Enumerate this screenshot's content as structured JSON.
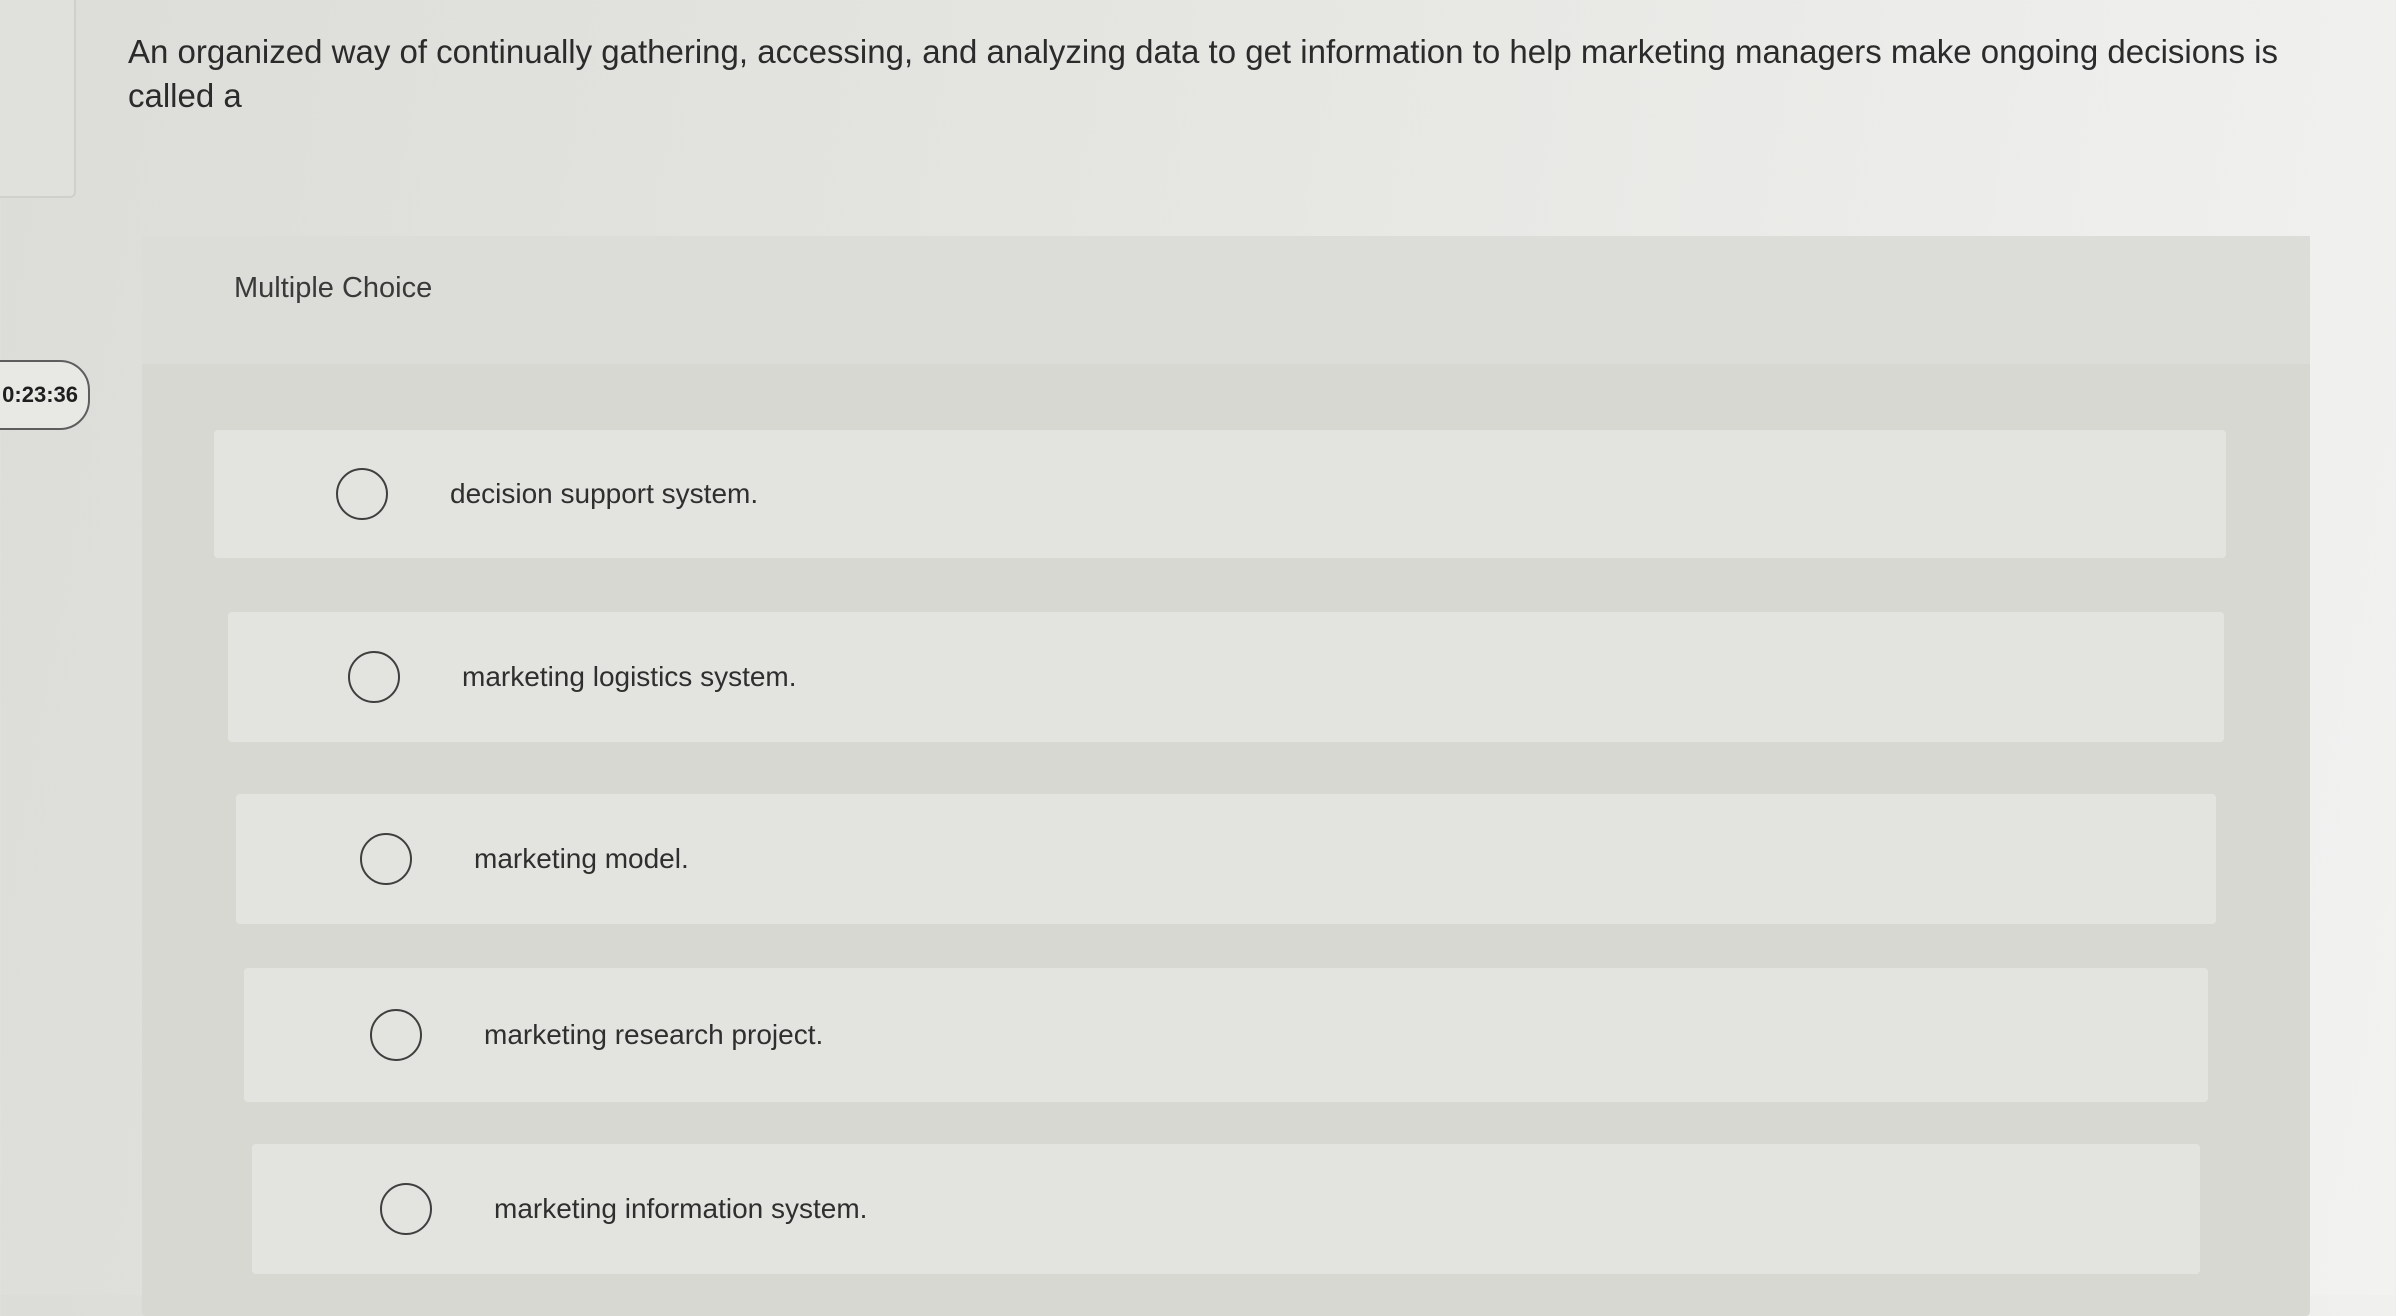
{
  "question": {
    "text": "An organized way of continually gathering, accessing, and analyzing data to get information to help marketing managers make ongoing decisions is called a"
  },
  "timer": {
    "value": "0:23:36"
  },
  "multiple_choice": {
    "label": "Multiple Choice",
    "options": [
      {
        "label": "decision support system.",
        "selected": false
      },
      {
        "label": "marketing logistics system.",
        "selected": false
      },
      {
        "label": "marketing model.",
        "selected": false
      },
      {
        "label": "marketing research project.",
        "selected": false
      },
      {
        "label": "marketing information system.",
        "selected": false
      }
    ]
  }
}
